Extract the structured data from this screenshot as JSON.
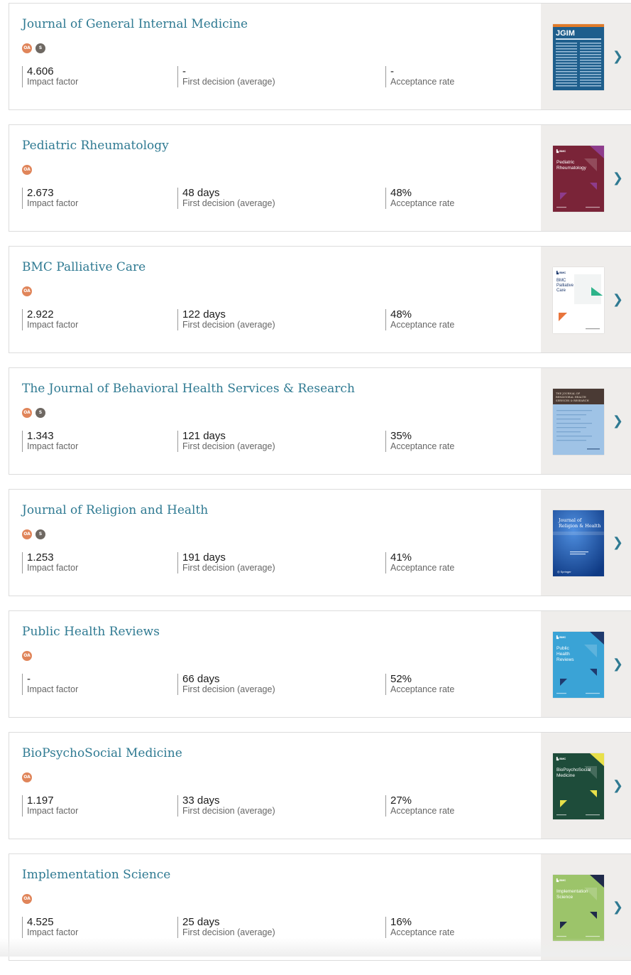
{
  "journals": [
    {
      "title": "Journal of General Internal Medicine",
      "badges": [
        "OA",
        "S"
      ],
      "impact_factor": "4.606",
      "first_decision": "-",
      "acceptance_rate": "-",
      "cover": {
        "style": "jgim",
        "color": "#1e5e8c",
        "text": "JGIM"
      }
    },
    {
      "title": "Pediatric Rheumatology",
      "badges": [
        "OA"
      ],
      "impact_factor": "2.673",
      "first_decision": "48 days",
      "acceptance_rate": "48%",
      "cover": {
        "style": "bmc",
        "color": "#7a2438",
        "accent": "#8e3c8c",
        "text": "Pediatric Rheumatology"
      }
    },
    {
      "title": "BMC Palliative Care",
      "badges": [
        "OA"
      ],
      "impact_factor": "2.922",
      "first_decision": "122 days",
      "acceptance_rate": "48%",
      "cover": {
        "style": "bmc-light",
        "color": "#ffffff",
        "accent": "#2db38a",
        "accent2": "#e8743b",
        "text": "BMC Palliative Care"
      }
    },
    {
      "title": "The Journal of Behavioral Health Services & Research",
      "badges": [
        "OA",
        "S"
      ],
      "impact_factor": "1.343",
      "first_decision": "121 days",
      "acceptance_rate": "35%",
      "cover": {
        "style": "jbhsr",
        "color": "#9fc3e6",
        "accent": "#4a3a34",
        "text": "The Journal of Behavioral Health Services & Research"
      }
    },
    {
      "title": "Journal of Religion and Health",
      "badges": [
        "OA",
        "S"
      ],
      "impact_factor": "1.253",
      "first_decision": "191 days",
      "acceptance_rate": "41%",
      "cover": {
        "style": "jrh",
        "color": "#1e56a6",
        "text": "Journal of Religion & Health"
      }
    },
    {
      "title": "Public Health Reviews",
      "badges": [
        "OA"
      ],
      "impact_factor": "-",
      "first_decision": "66 days",
      "acceptance_rate": "52%",
      "cover": {
        "style": "bmc",
        "color": "#3aa3d6",
        "accent": "#1f3a6e",
        "text": "Public Health Reviews"
      }
    },
    {
      "title": "BioPsychoSocial Medicine",
      "badges": [
        "OA"
      ],
      "impact_factor": "1.197",
      "first_decision": "33 days",
      "acceptance_rate": "27%",
      "cover": {
        "style": "bmc",
        "color": "#1e4c3a",
        "accent": "#e8e04a",
        "text": "BioPsychoSocial Medicine"
      }
    },
    {
      "title": "Implementation Science",
      "badges": [
        "OA"
      ],
      "impact_factor": "4.525",
      "first_decision": "25 days",
      "acceptance_rate": "16%",
      "cover": {
        "style": "bmc",
        "color": "#9cc46a",
        "accent": "#1f2a4a",
        "text": "Implementation Science"
      }
    }
  ],
  "labels": {
    "impact_factor": "Impact factor",
    "first_decision": "First decision (average)",
    "acceptance_rate": "Acceptance rate"
  },
  "icons": {
    "chevron": "chevron-right-icon"
  }
}
